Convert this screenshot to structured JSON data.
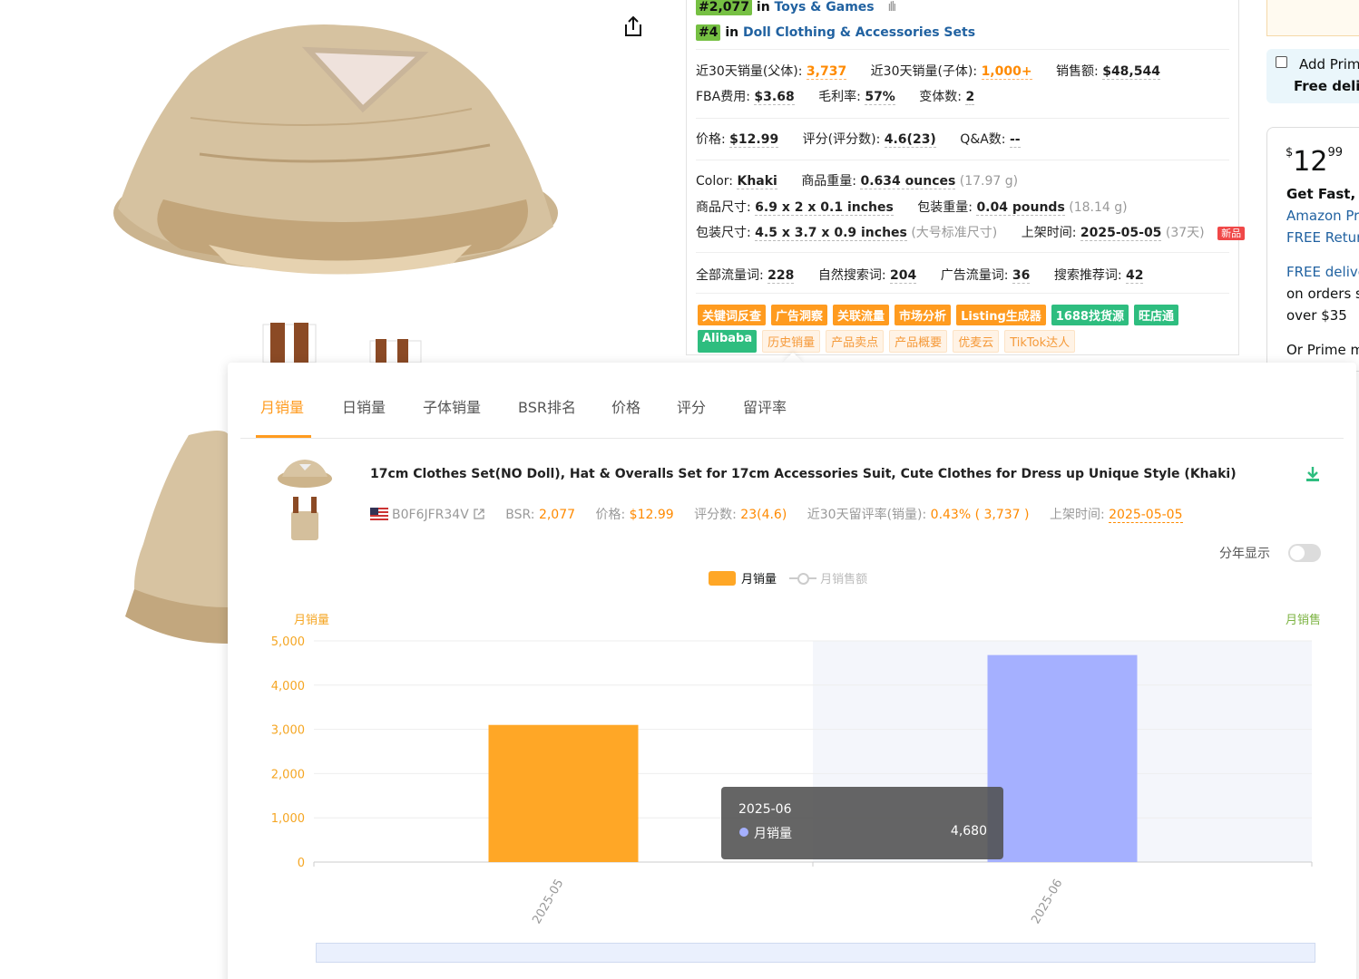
{
  "header": {
    "rank1": {
      "num": "#2,077",
      "prefix": "in",
      "category": "Toys & Games",
      "chart_icon": "bar-chart-icon"
    },
    "rank2": {
      "num": "#4",
      "prefix": "in",
      "category": "Doll Clothing & Accessories Sets"
    }
  },
  "stats": {
    "r1": [
      {
        "label": "近30天销量(父体): ",
        "value": "3,737",
        "accent": true
      },
      {
        "label": "近30天销量(子体): ",
        "value": "1,000+",
        "accent": true
      },
      {
        "label": "销售额: ",
        "value": "$48,544",
        "accent": false
      }
    ],
    "r2": [
      {
        "label": "FBA费用: ",
        "value": "$3.68"
      },
      {
        "label": "毛利率: ",
        "value": "57%"
      },
      {
        "label": "变体数: ",
        "value": "2"
      }
    ],
    "r3": [
      {
        "label": "价格: ",
        "value": "$12.99"
      },
      {
        "label": "评分(评分数): ",
        "value": "4.6(23)"
      },
      {
        "label": "Q&A数: ",
        "value": "--"
      }
    ],
    "r4": [
      {
        "label": "Color:  ",
        "value": "Khaki",
        "extra": ""
      },
      {
        "label": "商品重量: ",
        "value": "0.634 ounces",
        "extra": " (17.97 g)"
      }
    ],
    "r5": [
      {
        "label": "商品尺寸: ",
        "value": "6.9 x 2 x 0.1 inches",
        "extra": ""
      },
      {
        "label": "包装重量: ",
        "value": "0.04 pounds",
        "extra": " (18.14 g)"
      }
    ],
    "r6": [
      {
        "label": "包装尺寸: ",
        "value": "4.5 x 3.7 x 0.9 inches",
        "extra": " (大号标准尺寸)"
      },
      {
        "label": "上架时间: ",
        "value": "2025-05-05",
        "extra": " (37天)"
      }
    ],
    "new_badge": "新品",
    "r7": [
      {
        "label": "全部流量词: ",
        "value": "228"
      },
      {
        "label": "自然搜索词: ",
        "value": "204"
      },
      {
        "label": "广告流量词: ",
        "value": "36"
      },
      {
        "label": "搜索推荐词: ",
        "value": "42"
      }
    ]
  },
  "tools_row1": [
    {
      "label": "关键词反查",
      "style": "solid-o"
    },
    {
      "label": "广告洞察",
      "style": "solid-o"
    },
    {
      "label": "关联流量",
      "style": "solid-o"
    },
    {
      "label": "市场分析",
      "style": "solid-o"
    },
    {
      "label": "Listing生成器",
      "style": "solid-o"
    },
    {
      "label": "1688找货源",
      "style": "solid-g"
    },
    {
      "label": "旺店通",
      "style": "solid-g"
    }
  ],
  "tools_row2": [
    {
      "label": "Alibaba",
      "style": "solid-g"
    },
    {
      "label": "历史销量",
      "style": "light"
    },
    {
      "label": "产品卖点",
      "style": "light"
    },
    {
      "label": "产品概要",
      "style": "light"
    },
    {
      "label": "优麦云",
      "style": "light"
    },
    {
      "label": "TikTok达人",
      "style": "light"
    }
  ],
  "buybox": {
    "prime_add": "Add Prim",
    "prime_free": "Free deliv",
    "price_currency": "$",
    "price_main": "12",
    "price_cents": "99",
    "lines": [
      "Get Fast, F",
      "Amazon Pr",
      "FREE Retur",
      "FREE delive",
      "on orders s",
      "over $35",
      "Or Prime m"
    ]
  },
  "panel": {
    "tabs": [
      "月销量",
      "日销量",
      "子体销量",
      "BSR排名",
      "价格",
      "评分",
      "留评率"
    ],
    "active_tab": 0,
    "title": "17cm Clothes Set(NO Doll), Hat & Overalls Set for 17cm Accessories Suit, Cute Clothes for Dress up Unique Style (Khaki)",
    "asin": "B0F6JFR34V",
    "bsr_label": "BSR: ",
    "bsr": "2,077",
    "price_label": "价格: ",
    "price": "$12.99",
    "rating_label": "评分数: ",
    "rating": "23(4.6)",
    "review_label": "近30天留评率(销量): ",
    "review": "0.43% ( 3,737 )",
    "listed_label": "上架时间: ",
    "listed": "2025-05-05",
    "year_toggle": "分年显示",
    "legend_on": "月销量",
    "legend_off": "月销售额",
    "left_axis_name": "月销量",
    "right_axis_name": "月销售",
    "tooltip": {
      "date": "2025-06",
      "name": "月销量",
      "value": "4,680"
    }
  },
  "chart_data": {
    "type": "bar",
    "categories": [
      "2025-05",
      "2025-06"
    ],
    "series": [
      {
        "name": "月销量",
        "values": [
          3100,
          4680
        ]
      }
    ],
    "ylabel": "月销量",
    "ylim": [
      0,
      5000
    ],
    "yticks": [
      "0",
      "1,000",
      "2,000",
      "3,000",
      "4,000",
      "5,000"
    ],
    "colors": [
      "#ffa726",
      "#a5b0ff"
    ],
    "highlight_index": 1,
    "grid": true
  }
}
